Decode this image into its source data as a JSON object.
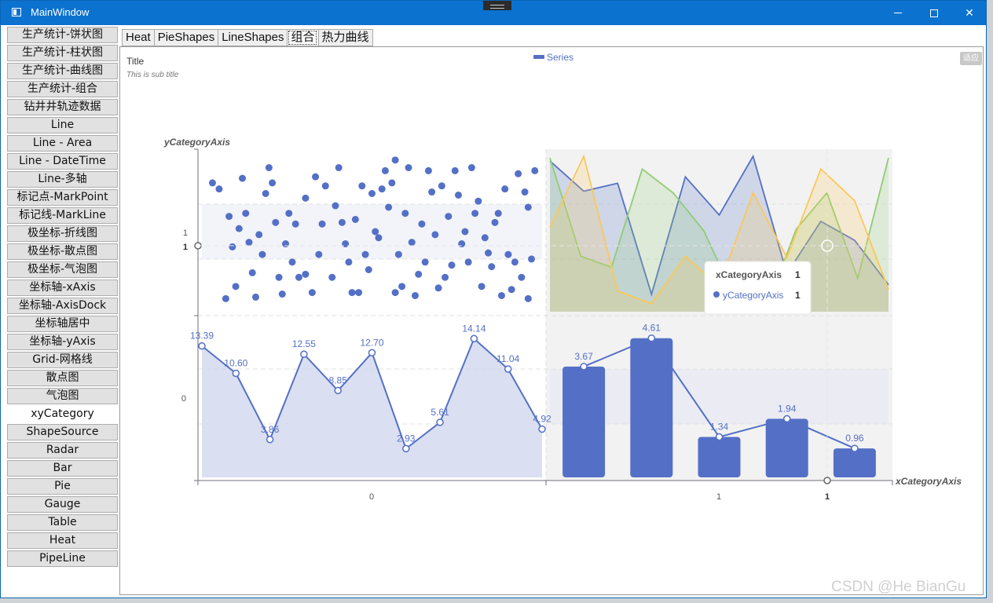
{
  "window": {
    "title": "MainWindow"
  },
  "sidebar": {
    "items": [
      {
        "label": "生产统计-饼状图"
      },
      {
        "label": "生产统计-柱状图"
      },
      {
        "label": "生产统计-曲线图"
      },
      {
        "label": "生产统计-组合"
      },
      {
        "label": "钻井井轨迹数据"
      },
      {
        "label": "Line"
      },
      {
        "label": "Line - Area"
      },
      {
        "label": "Line - DateTime"
      },
      {
        "label": "Line-多轴"
      },
      {
        "label": "标记点-MarkPoint"
      },
      {
        "label": "标记线-MarkLine"
      },
      {
        "label": "极坐标-折线图"
      },
      {
        "label": "极坐标-散点图"
      },
      {
        "label": "极坐标-气泡图"
      },
      {
        "label": "坐标轴-xAxis"
      },
      {
        "label": "坐标轴-AxisDock"
      },
      {
        "label": "坐标轴居中"
      },
      {
        "label": "坐标轴-yAxis"
      },
      {
        "label": "Grid-网格线"
      },
      {
        "label": "散点图"
      },
      {
        "label": "气泡图"
      },
      {
        "label": "xyCategory",
        "active": true
      },
      {
        "label": "ShapeSource"
      },
      {
        "label": "Radar"
      },
      {
        "label": "Bar"
      },
      {
        "label": "Pie"
      },
      {
        "label": "Gauge"
      },
      {
        "label": "Table"
      },
      {
        "label": "Heat"
      },
      {
        "label": "PipeLine"
      }
    ]
  },
  "tabs": [
    {
      "label": "Heat"
    },
    {
      "label": "PieShapes"
    },
    {
      "label": "LineShapes"
    },
    {
      "label": "组合",
      "active": true
    },
    {
      "label": "热力曲线"
    }
  ],
  "fit_button": "适应",
  "watermark": "CSDN @He BianGu",
  "tooltip": {
    "x_label": "xCategoryAxis",
    "x_value": "1",
    "y_label": "yCategoryAxis",
    "y_value": "1"
  },
  "colors": {
    "primary": "#5470c6",
    "green": "#91cc75",
    "yellow": "#fac858",
    "titlebar": "#0b72cf"
  },
  "chart_data": {
    "type": "line",
    "title": "Title",
    "subtitle": "This is sub title",
    "legend": [
      "Series"
    ],
    "legend_position": "top-center",
    "xlabel": "xCategoryAxis",
    "ylabel": "yCategoryAxis",
    "x_ticks": [
      "0",
      "1"
    ],
    "y_ticks": [
      "0",
      "1"
    ],
    "pointer_x_label": "1",
    "pointer_y_label": "1",
    "grid": true,
    "area_line": {
      "values": [
        13.39,
        10.6,
        3.86,
        12.55,
        8.85,
        12.7,
        2.93,
        5.61,
        14.14,
        11.04,
        4.92
      ],
      "labels": [
        "13.39",
        "10.60",
        "3.86",
        "12.55",
        "8.85",
        "12.70",
        "2.93",
        "5.61",
        "14.14",
        "11.04",
        "4.92"
      ]
    },
    "bars": {
      "values": [
        3.67,
        4.61,
        1.34,
        1.94,
        0.96
      ],
      "labels": [
        "3.67",
        "4.61",
        "1.34",
        "1.94",
        "0.96"
      ]
    },
    "multi_area": {
      "ymax": 10,
      "series": [
        {
          "color": "#5470c6",
          "values": [
            9.5,
            7.6,
            8.1,
            1.1,
            8.5,
            6.1,
            9.8,
            2.4,
            5.7,
            4.5,
            1.7
          ]
        },
        {
          "color": "#91cc75",
          "values": [
            9.7,
            3.5,
            2.8,
            9.0,
            7.5,
            5.1,
            0.9,
            0.1,
            5.2,
            7.5,
            2.1,
            9.7
          ]
        },
        {
          "color": "#fac858",
          "values": [
            5.3,
            9.8,
            1.3,
            0.5,
            3.5,
            1.6,
            7.5,
            3.4,
            9.0,
            7.0,
            1.4
          ]
        }
      ]
    },
    "scatter": {
      "points": [
        [
          0.02,
          0.82
        ],
        [
          0.04,
          0.78
        ],
        [
          0.06,
          0.06
        ],
        [
          0.07,
          0.6
        ],
        [
          0.08,
          0.4
        ],
        [
          0.1,
          0.52
        ],
        [
          0.11,
          0.85
        ],
        [
          0.12,
          0.62
        ],
        [
          0.13,
          0.43
        ],
        [
          0.14,
          0.23
        ],
        [
          0.15,
          0.07
        ],
        [
          0.16,
          0.48
        ],
        [
          0.17,
          0.35
        ],
        [
          0.18,
          0.75
        ],
        [
          0.19,
          0.92
        ],
        [
          0.2,
          0.82
        ],
        [
          0.22,
          0.2
        ],
        [
          0.23,
          0.09
        ],
        [
          0.24,
          0.42
        ],
        [
          0.25,
          0.62
        ],
        [
          0.26,
          0.3
        ],
        [
          0.27,
          0.55
        ],
        [
          0.28,
          0.2
        ],
        [
          0.3,
          0.22
        ],
        [
          0.32,
          0.1
        ],
        [
          0.34,
          0.35
        ],
        [
          0.35,
          0.55
        ],
        [
          0.36,
          0.8
        ],
        [
          0.38,
          0.2
        ],
        [
          0.4,
          0.92
        ],
        [
          0.41,
          0.56
        ],
        [
          0.42,
          0.42
        ],
        [
          0.43,
          0.3
        ],
        [
          0.44,
          0.1
        ],
        [
          0.45,
          0.58
        ],
        [
          0.47,
          0.8
        ],
        [
          0.48,
          0.35
        ],
        [
          0.5,
          0.75
        ],
        [
          0.51,
          0.5
        ],
        [
          0.52,
          0.46
        ],
        [
          0.53,
          0.78
        ],
        [
          0.54,
          0.9
        ],
        [
          0.55,
          0.66
        ],
        [
          0.56,
          0.82
        ],
        [
          0.57,
          0.1
        ],
        [
          0.58,
          0.35
        ],
        [
          0.6,
          0.62
        ],
        [
          0.61,
          0.92
        ],
        [
          0.62,
          0.43
        ],
        [
          0.63,
          0.08
        ],
        [
          0.64,
          0.22
        ],
        [
          0.65,
          0.55
        ],
        [
          0.66,
          0.3
        ],
        [
          0.67,
          0.9
        ],
        [
          0.68,
          0.76
        ],
        [
          0.7,
          0.13
        ],
        [
          0.71,
          0.8
        ],
        [
          0.72,
          0.2
        ],
        [
          0.73,
          0.6
        ],
        [
          0.74,
          0.28
        ],
        [
          0.75,
          0.9
        ],
        [
          0.76,
          0.74
        ],
        [
          0.77,
          0.42
        ],
        [
          0.78,
          0.5
        ],
        [
          0.8,
          0.92
        ],
        [
          0.81,
          0.62
        ],
        [
          0.82,
          0.7
        ],
        [
          0.83,
          0.14
        ],
        [
          0.84,
          0.46
        ],
        [
          0.85,
          0.36
        ],
        [
          0.86,
          0.27
        ],
        [
          0.87,
          0.56
        ],
        [
          0.88,
          0.62
        ],
        [
          0.9,
          0.78
        ],
        [
          0.91,
          0.35
        ],
        [
          0.92,
          0.12
        ],
        [
          0.93,
          0.3
        ],
        [
          0.94,
          0.88
        ],
        [
          0.95,
          0.2
        ],
        [
          0.96,
          0.76
        ],
        [
          0.97,
          0.06
        ],
        [
          0.98,
          0.32
        ],
        [
          0.99,
          0.9
        ],
        [
          0.3,
          0.72
        ],
        [
          0.46,
          0.1
        ],
        [
          0.59,
          0.14
        ],
        [
          0.69,
          0.48
        ],
        [
          0.09,
          0.14
        ],
        [
          0.21,
          0.56
        ],
        [
          0.33,
          0.86
        ],
        [
          0.39,
          0.67
        ],
        [
          0.49,
          0.25
        ],
        [
          0.57,
          0.97
        ],
        [
          0.79,
          0.3
        ],
        [
          0.89,
          0.08
        ],
        [
          0.97,
          0.66
        ]
      ]
    }
  }
}
